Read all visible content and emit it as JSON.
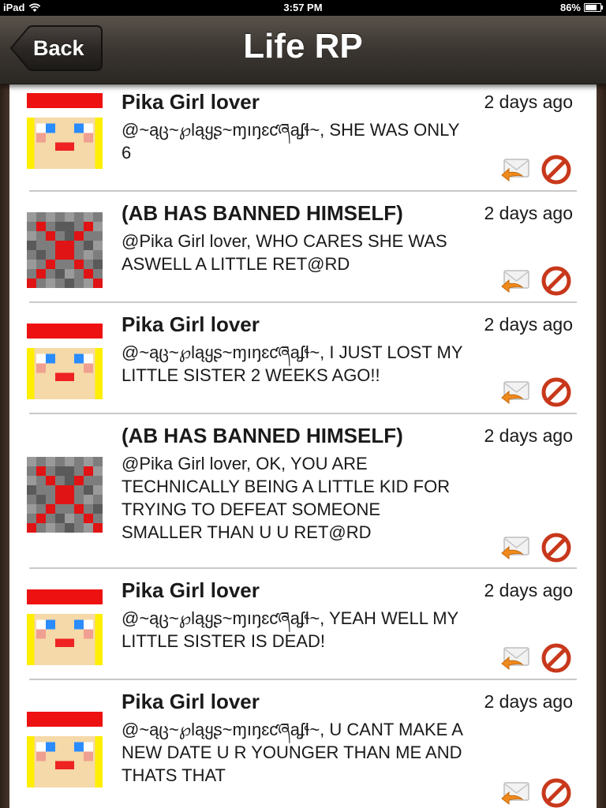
{
  "status": {
    "carrier": "iPad",
    "time": "3:57 PM",
    "battery": "86%",
    "battery_level": 0.86
  },
  "nav": {
    "back_label": "Back",
    "title": "Life RP"
  },
  "colors": {
    "block_red": "#c8381b",
    "reply_orange": "#f08a1c",
    "divider": "#c9c9c9"
  },
  "posts": [
    {
      "author": "Pika Girl lover",
      "avatar": "pika-girl-avatar",
      "time": "2 days ago",
      "lines": [
        "@~ąც~℘ląყʂ~ɱıŋɛƈཞąʄɬ~, SHE WAS ONLY",
        "6"
      ]
    },
    {
      "author": "(AB HAS BANNED HIMSELF)",
      "avatar": "redstone-block-avatar",
      "time": "2 days ago",
      "lines": [
        "@Pika Girl lover, WHO CARES SHE WAS",
        "ASWELL A LITTLE RET@RD"
      ]
    },
    {
      "author": "Pika Girl lover",
      "avatar": "pika-girl-avatar",
      "time": "2 days ago",
      "lines": [
        "@~ąც~℘ląყʂ~ɱıŋɛƈཞąʄɬ~, I JUST LOST MY",
        "LITTLE SISTER 2 WEEKS AGO!!"
      ]
    },
    {
      "author": "(AB HAS BANNED HIMSELF)",
      "avatar": "redstone-block-avatar",
      "time": "2 days ago",
      "lines": [
        "@Pika Girl lover, OK, YOU ARE",
        "TECHNICALLY BEING A LITTLE KID FOR",
        "TRYING TO DEFEAT SOMEONE",
        "SMALLER THAN U U RET@RD"
      ]
    },
    {
      "author": "Pika Girl lover",
      "avatar": "pika-girl-avatar",
      "time": "2 days ago",
      "lines": [
        "@~ąც~℘ląყʂ~ɱıŋɛƈཞąʄɬ~, YEAH WELL MY",
        "LITTLE SISTER IS DEAD!"
      ]
    },
    {
      "author": "Pika Girl lover",
      "avatar": "pika-girl-avatar",
      "time": "2 days ago",
      "lines": [
        "@~ąც~℘ląყʂ~ɱıŋɛƈཞąʄɬ~, U CANT MAKE A",
        "NEW DATE U R YOUNGER THAN ME AND",
        "THATS THAT"
      ]
    }
  ]
}
